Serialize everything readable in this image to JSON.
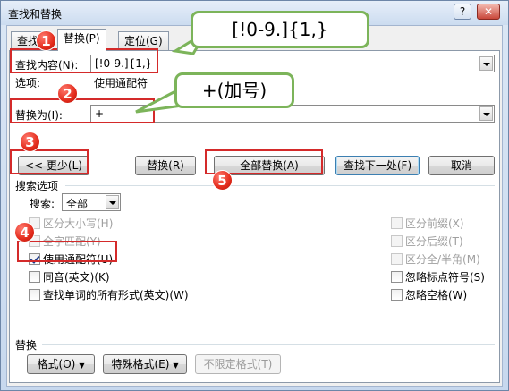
{
  "window": {
    "title": "查找和替换",
    "help_label": "?",
    "close_label": "✕"
  },
  "tabs": [
    {
      "label": "查找"
    },
    {
      "label": "替换(P)"
    },
    {
      "label": "定位(G)"
    }
  ],
  "find": {
    "label": "查找内容(N):",
    "value": "[!0-9.]{1,}",
    "options_label": "选项:",
    "options_value": "使用通配符"
  },
  "replace": {
    "label": "替换为(I):",
    "value": "+"
  },
  "buttons": {
    "less": "<< 更少(L)",
    "replace": "替换(R)",
    "replace_all": "全部替换(A)",
    "find_next": "查找下一处(F)",
    "cancel": "取消"
  },
  "search_options": {
    "group_label": "搜索选项",
    "search_label": "搜索:",
    "search_value": "全部",
    "left": [
      {
        "label": "区分大小写(H)",
        "checked": false,
        "enabled": false
      },
      {
        "label": "全字匹配(Y)",
        "checked": false,
        "enabled": false
      },
      {
        "label": "使用通配符(U)",
        "checked": true,
        "enabled": true
      },
      {
        "label": "同音(英文)(K)",
        "checked": false,
        "enabled": true
      },
      {
        "label": "查找单词的所有形式(英文)(W)",
        "checked": false,
        "enabled": true
      }
    ],
    "right": [
      {
        "label": "区分前缀(X)",
        "checked": false,
        "enabled": false
      },
      {
        "label": "区分后缀(T)",
        "checked": false,
        "enabled": false
      },
      {
        "label": "区分全/半角(M)",
        "checked": false,
        "enabled": false
      },
      {
        "label": "忽略标点符号(S)",
        "checked": false,
        "enabled": true
      },
      {
        "label": "忽略空格(W)",
        "checked": false,
        "enabled": true
      }
    ]
  },
  "replace_section": {
    "label": "替换",
    "format": "格式(O)",
    "special": "特殊格式(E)",
    "no_format": "不限定格式(T)"
  },
  "annotations": {
    "badges": [
      "1",
      "2",
      "3",
      "4",
      "5"
    ],
    "callout_find": "[!0-9.]{1,}",
    "callout_plus": "+(加号)"
  },
  "colors": {
    "highlight_red": "#d42a2a",
    "callout_green": "#7cb45a",
    "badge_red": "#e32b1c"
  }
}
